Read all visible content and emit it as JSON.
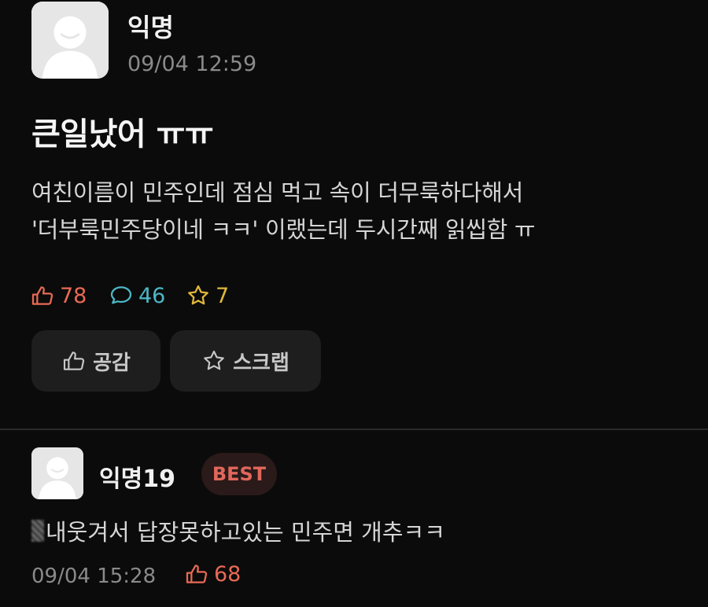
{
  "post": {
    "author": "익명",
    "time": "09/04 12:59",
    "title": "큰일났어 ㅠㅠ",
    "body_lines": [
      "여친이름이 민주인데 점심 먹고 속이 더무룩하다해서",
      "'더부룩민주당이네 ㅋㅋ' 이랬는데 두시간째 읽씹함 ㅠ"
    ],
    "stats": {
      "likes": "78",
      "comments": "46",
      "scraps": "7"
    },
    "buttons": {
      "like_label": "공감",
      "scrap_label": "스크랩"
    }
  },
  "comment": {
    "author": "익명19",
    "badge": "BEST",
    "text": "내웃겨서 답장못하고있는 민주면 개추ㅋㅋ",
    "time": "09/04 15:28",
    "likes": "68"
  },
  "colors": {
    "background": "#0b0b0b",
    "like": "#e86a55",
    "comment": "#4cb7c6",
    "scrap": "#e0b83a",
    "badge_text": "#e0675b"
  },
  "icons": {
    "like": "thumbs-up-icon",
    "comment": "speech-bubble-icon",
    "scrap": "star-icon",
    "avatar": "default-avatar-icon"
  }
}
